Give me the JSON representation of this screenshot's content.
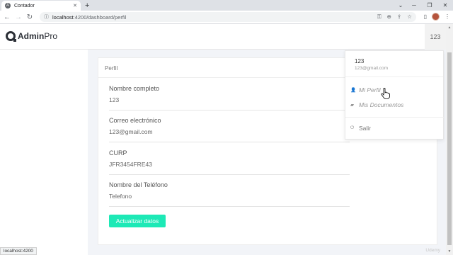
{
  "browser": {
    "tab_title": "Contador",
    "tab_close": "✕",
    "new_tab": "+",
    "url_host": "localhost",
    "url_path": ":4200/dashboard/perfil",
    "win_chevron": "⌄",
    "win_minimize": "─",
    "win_maximize": "❐",
    "win_close": "✕"
  },
  "app": {
    "logo_bold": "Admin",
    "logo_light": "Pro",
    "user_button": "123"
  },
  "card": {
    "title": "Perfil",
    "fields": [
      {
        "label": "Nombre completo",
        "value": "123"
      },
      {
        "label": "Correo electrónico",
        "value": "123@gmail.com"
      },
      {
        "label": "CURP",
        "value": "JFR3454FRE43"
      },
      {
        "label": "Nombre del Teléfono",
        "value": "Telefono"
      }
    ],
    "submit_label": "Actualizar datos"
  },
  "dropdown": {
    "name": "123",
    "email": "123@gmail.com",
    "items": [
      {
        "label": "Mi Perfil",
        "icon": "user-plus-icon"
      },
      {
        "label": "Mis Documentos",
        "icon": "folder-icon"
      }
    ],
    "logout_label": "Salir"
  },
  "status_bar": "localhost:4200",
  "watermark": "Udemy",
  "colors": {
    "accent": "#1de9b6",
    "main_bg": "#f2f4f8"
  }
}
